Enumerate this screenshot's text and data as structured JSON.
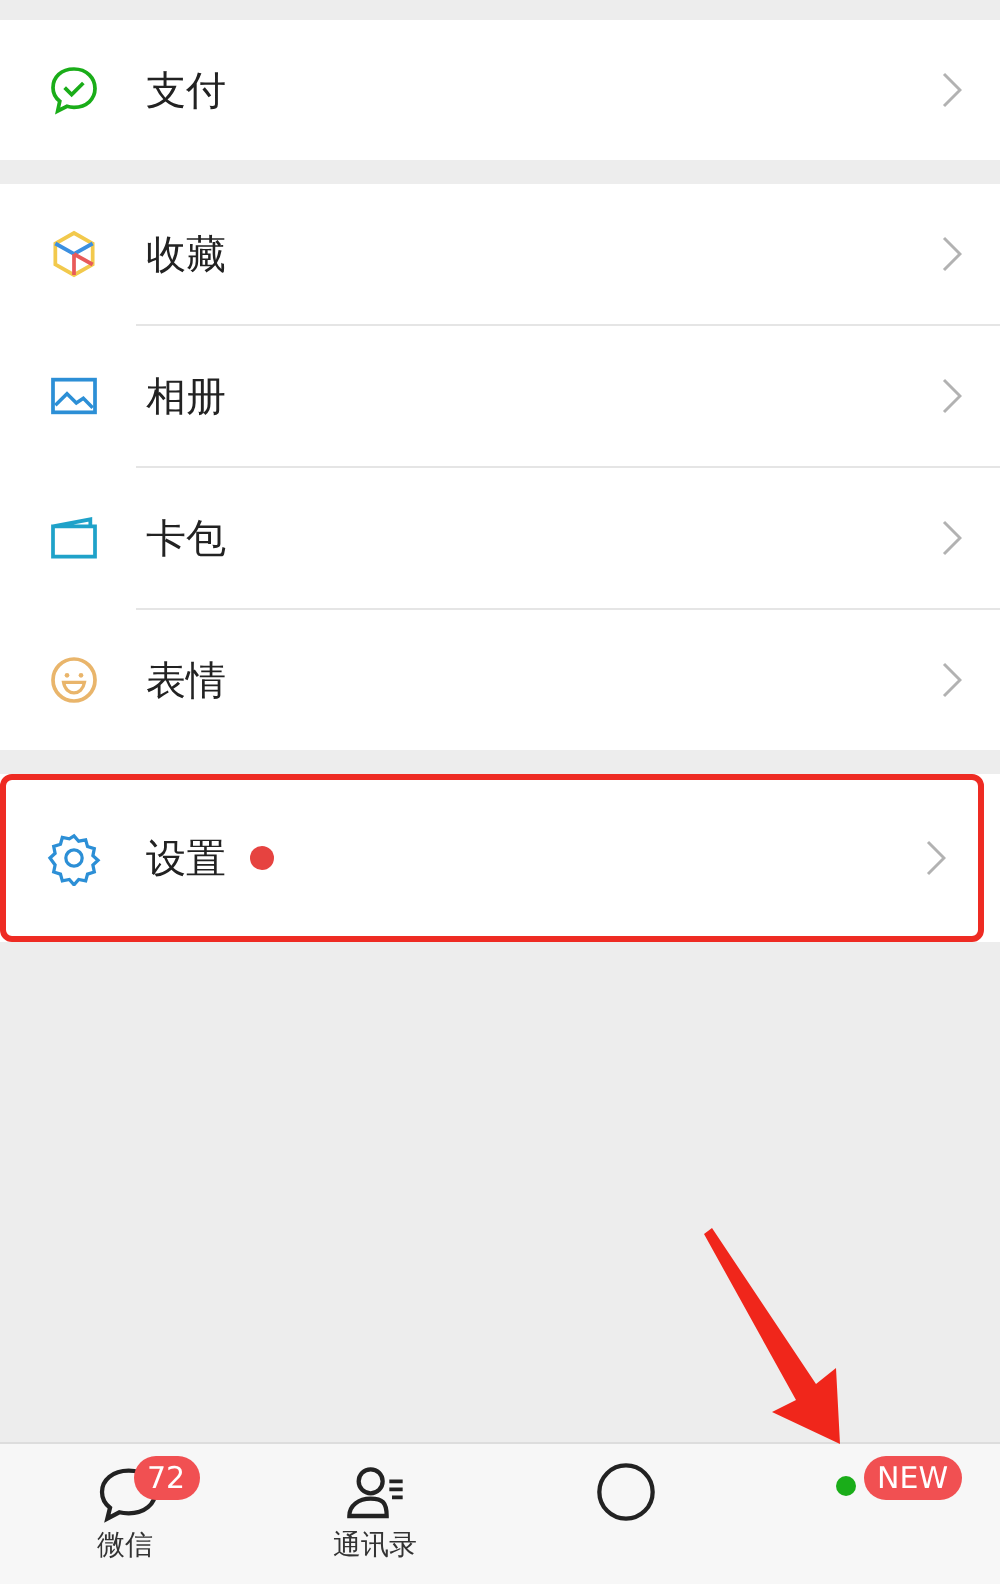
{
  "menu_groups": [
    {
      "items": [
        {
          "kind": "pay",
          "label": "支付",
          "dot": false,
          "highlighted": false
        }
      ]
    },
    {
      "items": [
        {
          "kind": "favorites",
          "label": "收藏",
          "dot": false,
          "highlighted": false
        },
        {
          "kind": "album",
          "label": "相册",
          "dot": false,
          "highlighted": false
        },
        {
          "kind": "cards",
          "label": "卡包",
          "dot": false,
          "highlighted": false
        },
        {
          "kind": "stickers",
          "label": "表情",
          "dot": false,
          "highlighted": false
        }
      ]
    },
    {
      "items": [
        {
          "kind": "settings",
          "label": "设置",
          "dot": true,
          "highlighted": true
        }
      ]
    }
  ],
  "tab_bar": [
    {
      "kind": "chat",
      "label": "微信",
      "badge": "72",
      "dot": false
    },
    {
      "kind": "contacts",
      "label": "通讯录",
      "dot": false
    },
    {
      "kind": "discover",
      "dot": false
    },
    {
      "kind": "me",
      "badge": "NEW",
      "dot": true
    }
  ],
  "annotations": [
    {
      "kind": "arrow"
    }
  ]
}
